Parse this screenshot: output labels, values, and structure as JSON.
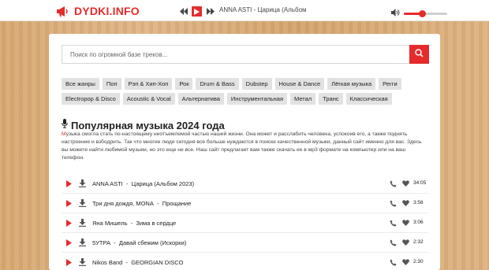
{
  "header": {
    "logo_text": "DYDKI.INFO",
    "now_playing": "ANNA ASTI - Царица (Альбом",
    "volume_level": 0.42,
    "accent": "#e52b2b"
  },
  "search": {
    "placeholder": "Поиск по огромной базе треков...",
    "icon": "search-icon"
  },
  "genres": {
    "row1": [
      "Все жанры",
      "Поп",
      "Рэп & Хип-Хоп",
      "Рок",
      "Drum & Bass",
      "Dubstep",
      "House & Dance",
      "Лёгкая музыка",
      "Регги"
    ],
    "row2": [
      "Electropop & Disco",
      "Acoustic & Vocal",
      "Альтернатива",
      "Инструментальная",
      "Метал",
      "Транс",
      "Классическая"
    ]
  },
  "main": {
    "heading": "Популярная музыка 2024 года",
    "description_first": "М",
    "description_rest": "узыка смогла стать по-настоящему неотъемлемой частью нашей жизни. Она может и расслабить человека, успокоив его, а также поднять настроение и взбодрить. Так что многие люди сегодня все больше нуждаются в поиске качественной музыки, данный сайт именно для вас. Здесь вы можете найти любимой музыки, но это еще не все. Наш сайт предлагает вам также скачать ее в мр3 формате на компьютер или на ваш телефон."
  },
  "tracks": [
    {
      "artist": "ANNA ASTI",
      "sep": "-",
      "song": "Царица (Альбом 2023)",
      "duration": "34:05"
    },
    {
      "artist": "Три дня дождя, MONA",
      "sep": "-",
      "song": "Прощание",
      "duration": "3:56"
    },
    {
      "artist": "Яна Мишель",
      "sep": "-",
      "song": "Зима в сердце",
      "duration": "3:06"
    },
    {
      "artist": "5УТРА",
      "sep": "-",
      "song": "Давай сбежим (Искорки)",
      "duration": "2:32"
    },
    {
      "artist": "Nikos Band",
      "sep": "-",
      "song": "GEORGIAN DISCO",
      "duration": "2:30"
    }
  ]
}
